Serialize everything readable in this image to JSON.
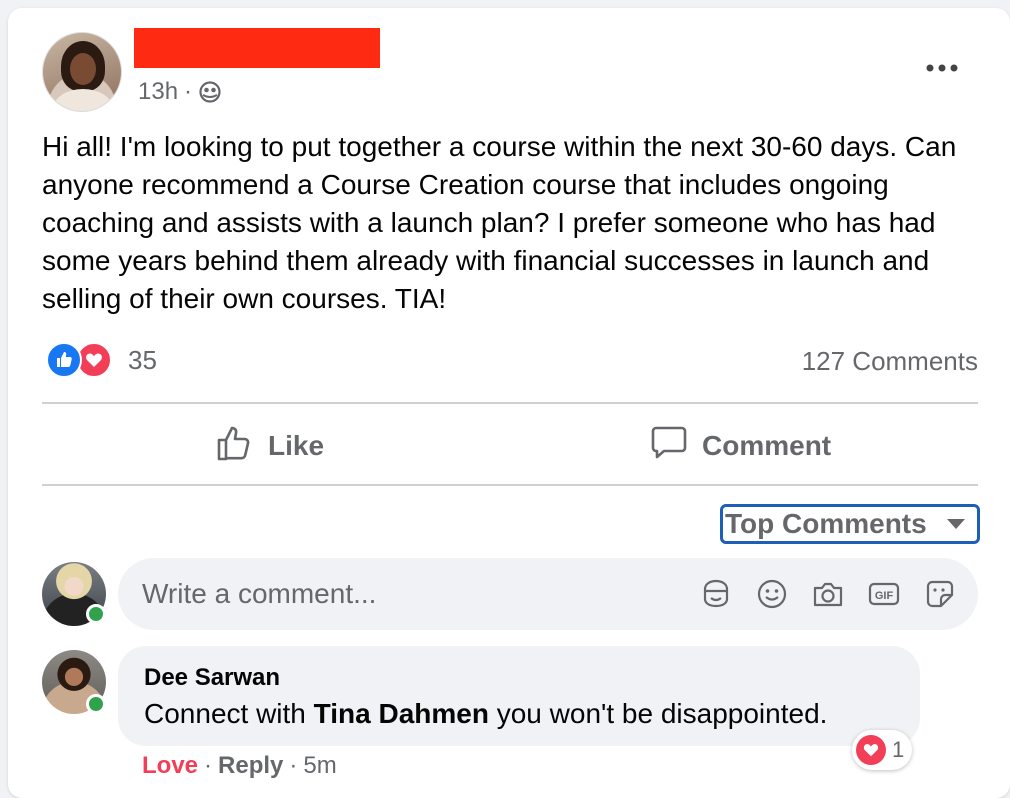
{
  "post": {
    "timestamp": "13h",
    "separator": "·",
    "audience_icon": "globe-icon",
    "body": "Hi all! I'm looking to put together a course within the next 30-60 days. Can anyone recommend a Course Creation course that includes ongoing coaching and assists with a launch plan? I prefer someone who has had some years behind them already with financial successes in launch and selling of their own courses. TIA!",
    "reaction_count": "35",
    "comments_count": "127 Comments"
  },
  "actions": {
    "like_label": "Like",
    "comment_label": "Comment"
  },
  "sort": {
    "label": "Top Comments"
  },
  "composer": {
    "placeholder": "Write a comment..."
  },
  "comment": {
    "author": "Dee Sarwan",
    "text_prefix": "Connect with ",
    "mention": "Tina Dahmen",
    "text_suffix": " you won't be disappointed.",
    "reaction_count": "1",
    "love_label": "Love",
    "reply_label": "Reply",
    "sep": "·",
    "time": "5m"
  },
  "colors": {
    "like_blue": "#1877f2",
    "love_red": "#f33e58",
    "online_green": "#31a24c",
    "redaction": "#ff2a12",
    "focus_blue": "#1b5fb8"
  }
}
